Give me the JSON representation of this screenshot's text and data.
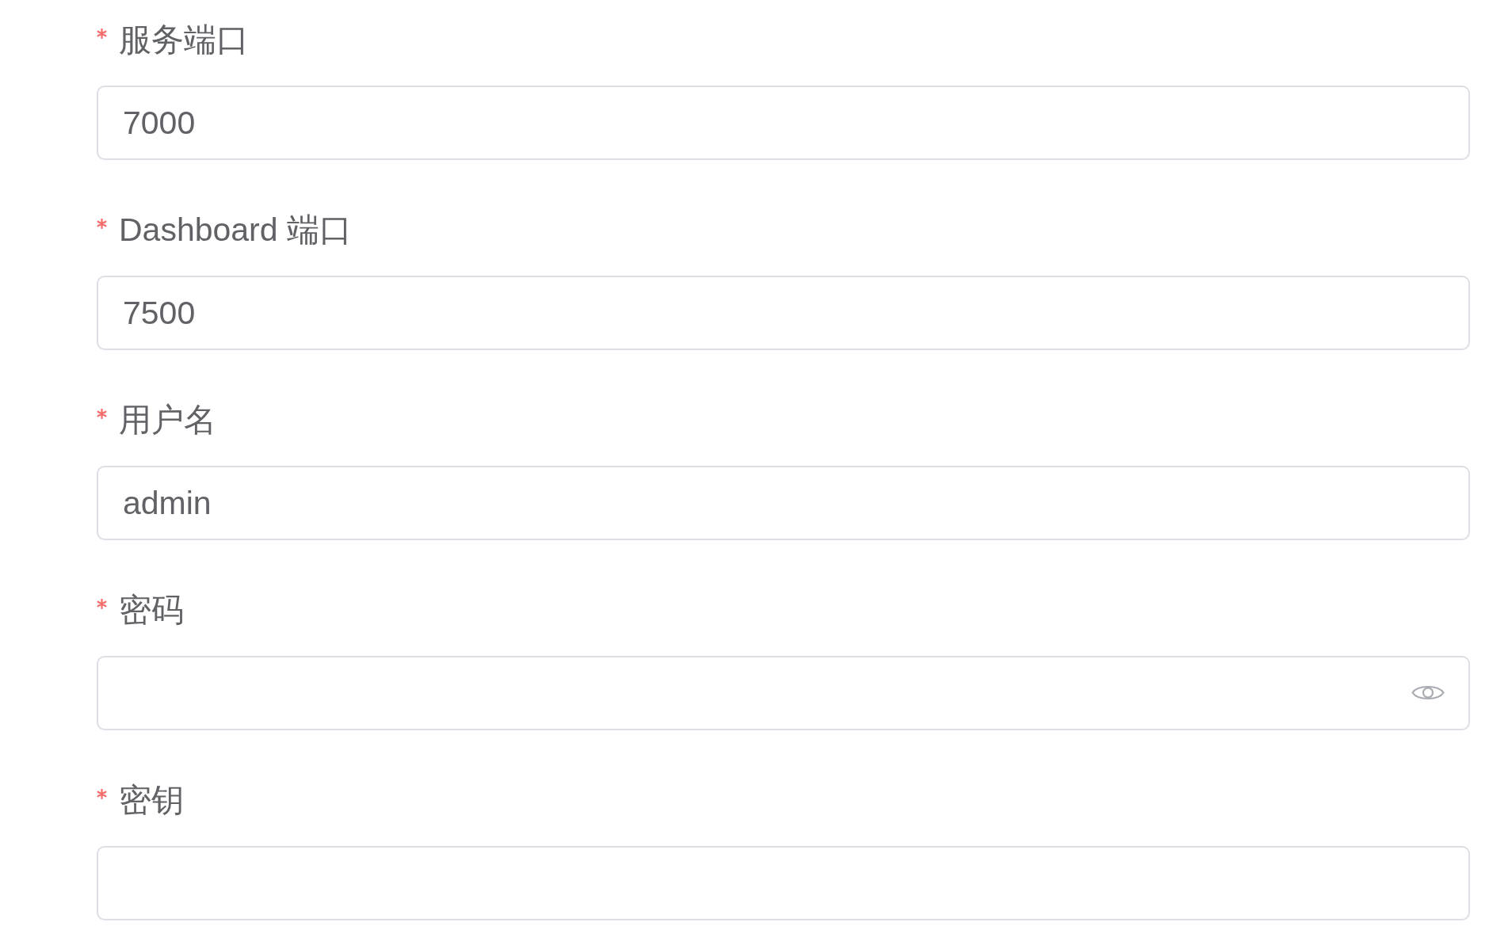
{
  "form": {
    "fields": [
      {
        "label": "服务端口",
        "required": true,
        "kind": "text",
        "value": "7000"
      },
      {
        "label": "Dashboard 端口",
        "required": true,
        "kind": "text",
        "value": "7500"
      },
      {
        "label": "用户名",
        "required": true,
        "kind": "text",
        "value": "admin"
      },
      {
        "label": "密码",
        "required": true,
        "kind": "password"
      },
      {
        "label": "密钥",
        "required": true,
        "kind": "text"
      }
    ]
  }
}
